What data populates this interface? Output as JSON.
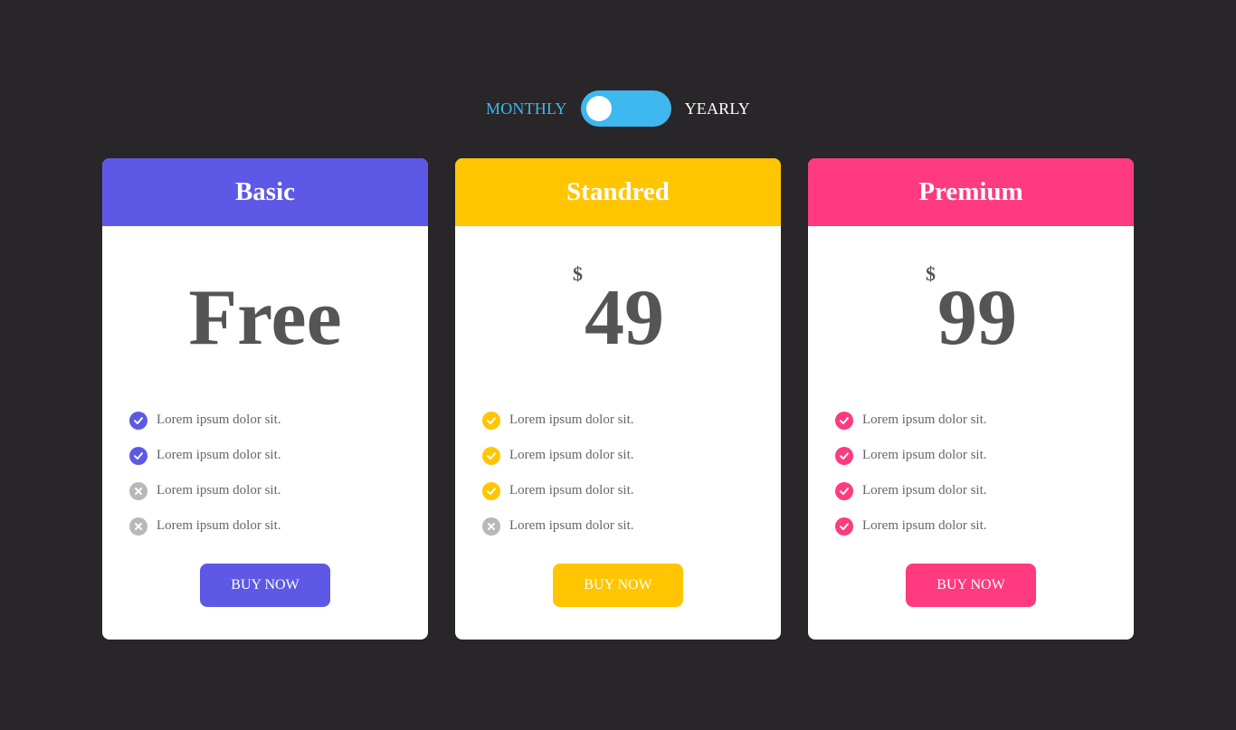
{
  "toggle": {
    "monthly_label": "MONTHLY",
    "yearly_label": "YEARLY",
    "selected": "monthly",
    "accent_color": "#3fb7ef"
  },
  "colors": {
    "background": "#282628",
    "basic": "#5d59e6",
    "standard": "#ffc500",
    "premium": "#ff3a7e",
    "disabled": "#b8b8b8",
    "price_text": "#555555"
  },
  "plans": [
    {
      "name": "Basic",
      "price": "Free",
      "currency": "",
      "features": [
        {
          "text": "Lorem ipsum dolor sit.",
          "included": true,
          "icon": "check-circle-icon"
        },
        {
          "text": "Lorem ipsum dolor sit.",
          "included": true,
          "icon": "check-circle-icon"
        },
        {
          "text": "Lorem ipsum dolor sit.",
          "included": false,
          "icon": "x-circle-icon"
        },
        {
          "text": "Lorem ipsum dolor sit.",
          "included": false,
          "icon": "x-circle-icon"
        }
      ],
      "button_label": "BUY NOW"
    },
    {
      "name": "Standred",
      "price": "49",
      "currency": "$",
      "features": [
        {
          "text": "Lorem ipsum dolor sit.",
          "included": true,
          "icon": "check-circle-icon"
        },
        {
          "text": "Lorem ipsum dolor sit.",
          "included": true,
          "icon": "check-circle-icon"
        },
        {
          "text": "Lorem ipsum dolor sit.",
          "included": true,
          "icon": "check-circle-icon"
        },
        {
          "text": "Lorem ipsum dolor sit.",
          "included": false,
          "icon": "x-circle-icon"
        }
      ],
      "button_label": "BUY NOW"
    },
    {
      "name": "Premium",
      "price": "99",
      "currency": "$",
      "features": [
        {
          "text": "Lorem ipsum dolor sit.",
          "included": true,
          "icon": "check-circle-icon"
        },
        {
          "text": "Lorem ipsum dolor sit.",
          "included": true,
          "icon": "check-circle-icon"
        },
        {
          "text": "Lorem ipsum dolor sit.",
          "included": true,
          "icon": "check-circle-icon"
        },
        {
          "text": "Lorem ipsum dolor sit.",
          "included": true,
          "icon": "check-circle-icon"
        }
      ],
      "button_label": "BUY NOW"
    }
  ]
}
